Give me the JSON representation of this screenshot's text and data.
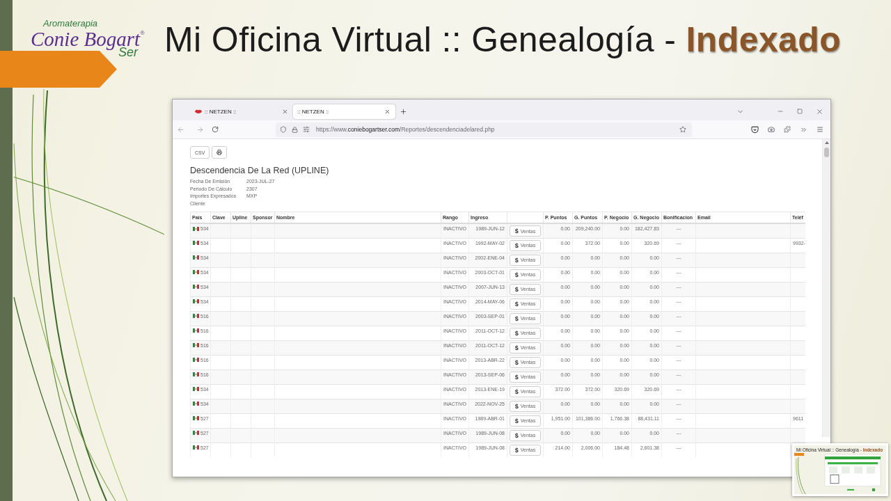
{
  "logo": {
    "tagline": "Aromaterapia",
    "name": "Conie Bogart$^{®}$",
    "sub": "Ser"
  },
  "title": "Mi Oficina Virtual :: Genealogía - **Indexado**",
  "browser": {
    "tabs": [
      {
        "label": ":: NETZEN ::",
        "selected": false,
        "favicon": true
      },
      {
        "label": ":: NETZEN ::",
        "selected": true,
        "favicon": false
      }
    ],
    "url": "https://www.**coniebogartser.com**/Reportes/descendenciadelared.php"
  },
  "report": {
    "buttons": [
      {
        "kind": "text",
        "label": "CSV"
      },
      {
        "kind": "print"
      }
    ],
    "title": "Descendencia De La Red (UPLINE)",
    "meta": [
      {
        "label": "Fecha De Emisión",
        "value": "2023-JUL-27"
      },
      {
        "label": "Periodo De Cálculo",
        "value": "2307"
      },
      {
        "label": "Importes Expresados",
        "value": "MXP"
      },
      {
        "label": "Cliente"
      }
    ]
  },
  "table": {
    "columns": [
      {
        "kind": "text",
        "label": "País"
      },
      {
        "kind": "text",
        "label": "Clave"
      },
      {
        "kind": "text",
        "label": "Upline"
      },
      {
        "kind": "text",
        "label": "Sponsor"
      },
      {
        "kind": "text",
        "label": "Nombre"
      },
      {
        "kind": "text",
        "label": "Rango"
      },
      {
        "kind": "text",
        "label": "Ingreso"
      },
      {
        "kind": "action"
      },
      {
        "kind": "text",
        "label": "P. Puntos"
      },
      {
        "kind": "text",
        "label": "G. Puntos"
      },
      {
        "kind": "text",
        "label": "P. Negocio"
      },
      {
        "kind": "text",
        "label": "G. Negocio"
      },
      {
        "kind": "text",
        "label": "Bonificacion"
      },
      {
        "kind": "text",
        "label": "Email"
      },
      {
        "kind": "text",
        "label": "Teléf"
      }
    ],
    "rows": [
      {
        "pais": "534",
        "rango": "INACTIVO",
        "ingreso": "1989-JUN-12",
        "action": "**$** Ventas",
        "p_puntos": "0.00",
        "g_puntos": "209,240.00",
        "p_negocio": "0.00",
        "g_negocio": "182,427.83",
        "bonificacion": "---"
      },
      {
        "pais": "534",
        "rango": "INACTIVO",
        "ingreso": "1992-MAY-02",
        "action": "**$** Ventas",
        "p_puntos": "0.00",
        "g_puntos": "372.00",
        "p_negocio": "0.00",
        "g_negocio": "320.69",
        "bonificacion": "---",
        "telefono": "9932-"
      },
      {
        "pais": "534",
        "rango": "INACTIVO",
        "ingreso": "2002-ENE-04",
        "action": "**$** Ventas",
        "p_puntos": "0.00",
        "g_puntos": "0.00",
        "p_negocio": "0.00",
        "g_negocio": "0.00",
        "bonificacion": "---"
      },
      {
        "pais": "534",
        "rango": "INACTIVO",
        "ingreso": "2003-OCT-01",
        "action": "**$** Ventas",
        "p_puntos": "0.00",
        "g_puntos": "0.00",
        "p_negocio": "0.00",
        "g_negocio": "0.00",
        "bonificacion": "---"
      },
      {
        "pais": "534",
        "rango": "INACTIVO",
        "ingreso": "2007-JUN-13",
        "action": "**$** Ventas",
        "p_puntos": "0.00",
        "g_puntos": "0.00",
        "p_negocio": "0.00",
        "g_negocio": "0.00",
        "bonificacion": "---"
      },
      {
        "pais": "534",
        "rango": "INACTIVO",
        "ingreso": "2014-MAY-06",
        "action": "**$** Ventas",
        "p_puntos": "0.00",
        "g_puntos": "0.00",
        "p_negocio": "0.00",
        "g_negocio": "0.00",
        "bonificacion": "---"
      },
      {
        "pais": "516",
        "rango": "INACTIVO",
        "ingreso": "2003-SEP-01",
        "action": "**$** Ventas",
        "p_puntos": "0.00",
        "g_puntos": "0.00",
        "p_negocio": "0.00",
        "g_negocio": "0.00",
        "bonificacion": "---"
      },
      {
        "pais": "516",
        "rango": "INACTIVO",
        "ingreso": "2011-OCT-12",
        "action": "**$** Ventas",
        "p_puntos": "0.00",
        "g_puntos": "0.00",
        "p_negocio": "0.00",
        "g_negocio": "0.00",
        "bonificacion": "---"
      },
      {
        "pais": "516",
        "rango": "INACTIVO",
        "ingreso": "2011-OCT-12",
        "action": "**$** Ventas",
        "p_puntos": "0.00",
        "g_puntos": "0.00",
        "p_negocio": "0.00",
        "g_negocio": "0.00",
        "bonificacion": "---"
      },
      {
        "pais": "516",
        "rango": "INACTIVO",
        "ingreso": "2013-ABR-22",
        "action": "**$** Ventas",
        "p_puntos": "0.00",
        "g_puntos": "0.00",
        "p_negocio": "0.00",
        "g_negocio": "0.00",
        "bonificacion": "---"
      },
      {
        "pais": "516",
        "rango": "INACTIVO",
        "ingreso": "2013-SEP-06",
        "action": "**$** Ventas",
        "p_puntos": "0.00",
        "g_puntos": "0.00",
        "p_negocio": "0.00",
        "g_negocio": "0.00",
        "bonificacion": "---"
      },
      {
        "pais": "534",
        "rango": "INACTIVO",
        "ingreso": "2013-ENE-19",
        "action": "**$** Ventas",
        "p_puntos": "372.00",
        "g_puntos": "372.00",
        "p_negocio": "320.69",
        "g_negocio": "320.69",
        "bonificacion": "---"
      },
      {
        "pais": "534",
        "rango": "INACTIVO",
        "ingreso": "2022-NOV-25",
        "action": "**$** Ventas",
        "p_puntos": "0.00",
        "g_puntos": "0.00",
        "p_negocio": "0.00",
        "g_negocio": "0.00",
        "bonificacion": "---"
      },
      {
        "pais": "527",
        "rango": "INACTIVO",
        "ingreso": "1989-ABR-01",
        "action": "**$** Ventas",
        "p_puntos": "1,951.00",
        "g_puntos": "101,386.00",
        "p_negocio": "1,766.38",
        "g_negocio": "88,431.11",
        "bonificacion": "---",
        "telefono": "9611"
      },
      {
        "pais": "527",
        "rango": "INACTIVO",
        "ingreso": "1989-JUN-08",
        "action": "**$** Ventas",
        "p_puntos": "0.00",
        "g_puntos": "0.00",
        "p_negocio": "0.00",
        "g_negocio": "0.00",
        "bonificacion": "---"
      },
      {
        "pais": "527",
        "rango": "INACTIVO",
        "ingreso": "1989-JUN-08",
        "action": "**$** Ventas",
        "p_puntos": "214.00",
        "g_puntos": "2,006.00",
        "p_negocio": "184.48",
        "g_negocio": "2,601.38",
        "bonificacion": "---"
      }
    ]
  },
  "thumbnail": {
    "title": "Mi Oficina Virtual :: Genealogía - **Indexado**"
  }
}
